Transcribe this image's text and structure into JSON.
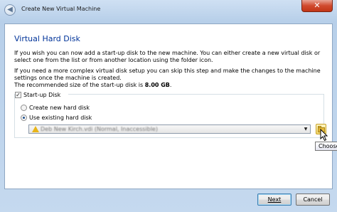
{
  "window": {
    "title": "Create New Virtual Machine",
    "close_glyph": "✕"
  },
  "page": {
    "heading": "Virtual Hard Disk",
    "paragraph1": "If you wish you can now add a start-up disk to the new machine. You can either create a new virtual disk or select one from the list or from another location using the folder icon.",
    "paragraph2": "If you need a more complex virtual disk setup you can skip this step and make the changes to the machine settings once the machine is created.",
    "recommended_prefix": "The recommended size of the start-up disk is ",
    "recommended_size": "8.00 GB",
    "recommended_suffix": "."
  },
  "startup_disk": {
    "checkbox_label": "Start-up Disk",
    "checked": true,
    "options": [
      {
        "label": "Create new hard disk",
        "selected": false
      },
      {
        "label": "Use existing hard disk",
        "selected": true
      }
    ],
    "selected_disk": "Deb New Kirch.vdi (Normal, Inaccessible)",
    "warning_icon": "warning-icon",
    "folder_icon": "folder-icon"
  },
  "tooltip": {
    "text": "Choose"
  },
  "buttons": {
    "next": "Next",
    "cancel": "Cancel"
  },
  "colors": {
    "heading": "#003399",
    "close_button": "#c9452a",
    "warning": "#e8b51a"
  }
}
